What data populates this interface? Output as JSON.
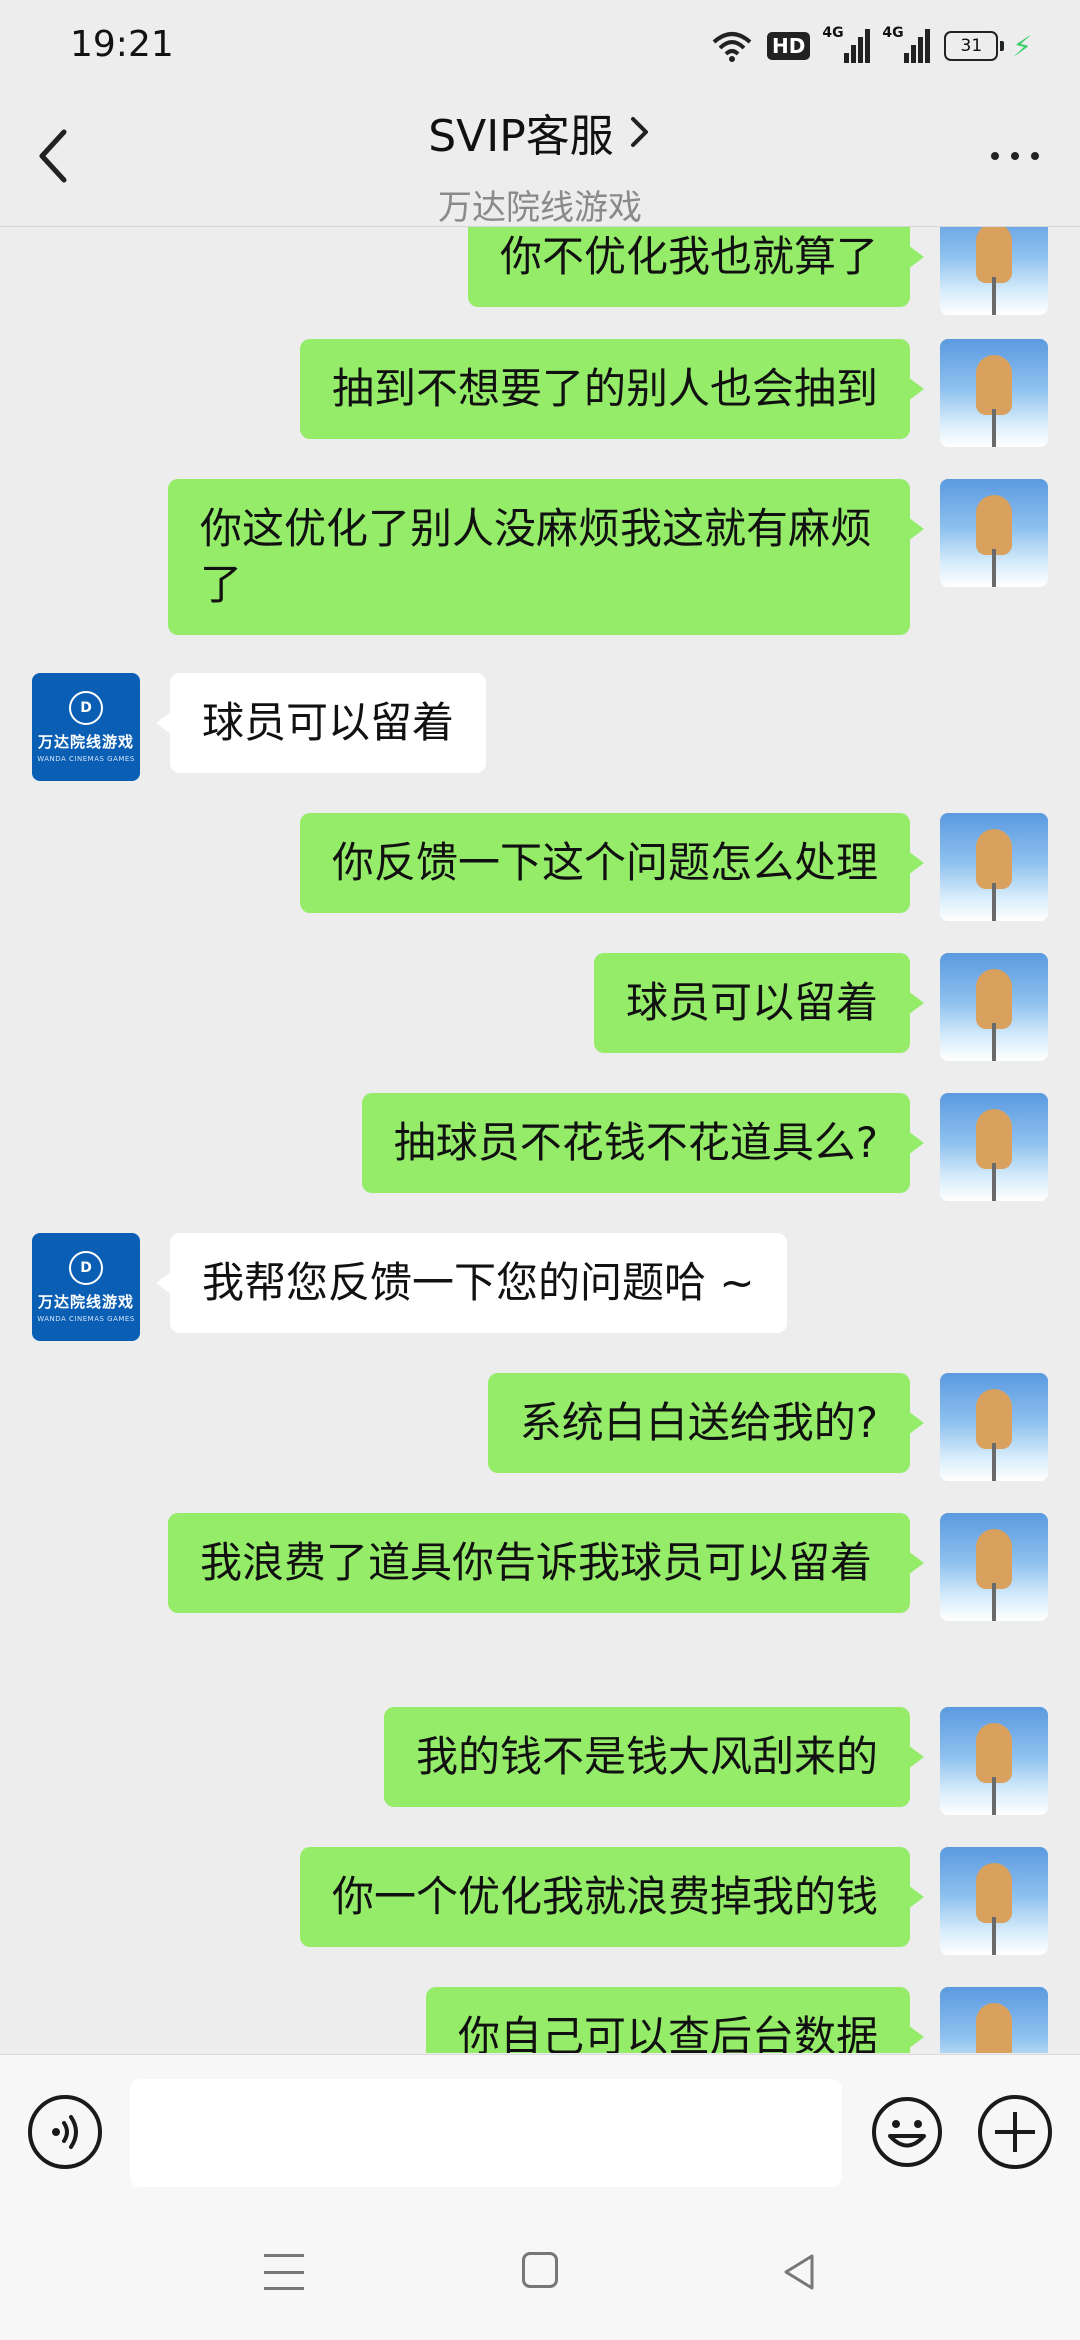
{
  "status_bar": {
    "time": "19:21",
    "hd_label": "HD",
    "net1_label": "4G",
    "net2_label": "4G",
    "battery": "31",
    "icons": [
      "wifi-icon",
      "hd-icon",
      "signal-icon",
      "signal-icon",
      "battery-icon",
      "charging-icon"
    ]
  },
  "header": {
    "title": "SVIP客服",
    "subtitle": "万达院线游戏",
    "icons": [
      "back-icon",
      "chevron-right-icon",
      "more-icon"
    ]
  },
  "bot": {
    "logo_text": "D",
    "name": "万达院线游戏",
    "name_en": "WANDA CINEMAS GAMES"
  },
  "messages": [
    {
      "side": "out",
      "text": "你不优化我也就算了"
    },
    {
      "side": "out",
      "text": "抽到不想要了的别人也会抽到"
    },
    {
      "side": "out",
      "text": "你这优化了别人没麻烦我这就有麻烦了"
    },
    {
      "side": "in",
      "text": "球员可以留着"
    },
    {
      "side": "out",
      "text": "你反馈一下这个问题怎么处理"
    },
    {
      "side": "out",
      "text": "球员可以留着"
    },
    {
      "side": "out",
      "text": "抽球员不花钱不花道具么?"
    },
    {
      "side": "in",
      "text": "我帮您反馈一下您的问题哈 ~"
    },
    {
      "side": "out",
      "text": "系统白白送给我的?"
    },
    {
      "side": "out",
      "text": "我浪费了道具你告诉我球员可以留着"
    },
    {
      "side": "out",
      "text": "我的钱不是钱大风刮来的"
    },
    {
      "side": "out",
      "text": "你一个优化我就浪费掉我的钱"
    },
    {
      "side": "out",
      "text": "你自己可以查后台数据"
    }
  ],
  "input_bar": {
    "placeholder": "",
    "icons": [
      "voice-icon",
      "emoji-icon",
      "plus-icon"
    ]
  },
  "nav_bar": {
    "icons": [
      "nav-menu-icon",
      "nav-home-icon",
      "nav-back-icon"
    ]
  },
  "colors": {
    "background": "#ededed",
    "outgoing_bubble": "#95ec69",
    "incoming_bubble": "#ffffff",
    "bot_avatar": "#0a5fb5",
    "charging": "#3ecf6b"
  }
}
